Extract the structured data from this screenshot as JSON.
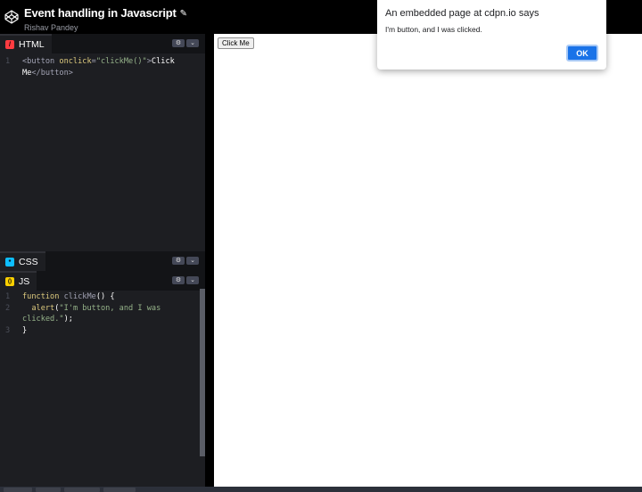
{
  "header": {
    "title": "Event handling in Javascript",
    "author": "Rishav Pandey"
  },
  "editors": {
    "html": {
      "label": "HTML",
      "badge": "/",
      "badge_color": "#ff3c41",
      "line_number": "1"
    },
    "css": {
      "label": "CSS",
      "badge": "*",
      "badge_color": "#0ebeff"
    },
    "js": {
      "label": "JS",
      "badge": "()",
      "badge_color": "#fcd000",
      "line_numbers": [
        "1",
        "2",
        "3"
      ]
    },
    "settings_icon": "⚙",
    "collapse_icon": "⌄"
  },
  "preview": {
    "button_label": "Click Me"
  },
  "dialog": {
    "title": "An embedded page at cdpn.io says",
    "message": "I'm button, and I was clicked.",
    "ok_label": "OK"
  },
  "colors": {
    "ok_button": "#1a73e8",
    "editor_bg": "#1d1e22"
  }
}
